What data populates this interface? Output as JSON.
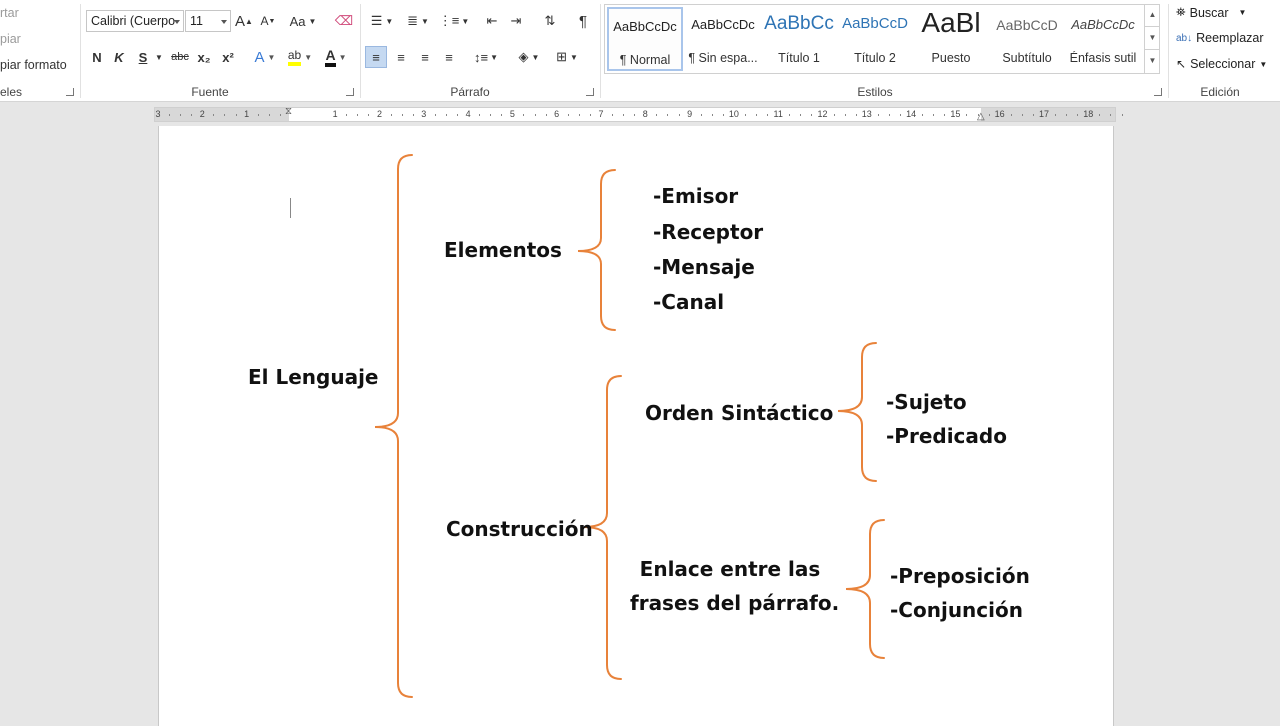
{
  "clipboard": {
    "cut_label": "rtar",
    "copy_label": "piar",
    "format_painter_label": "piar formato",
    "group_label": "eles"
  },
  "font": {
    "family_value": "Calibri (Cuerpo",
    "size_value": "11",
    "group_label": "Fuente",
    "bold": "N",
    "italic": "K",
    "underline": "S",
    "strikethrough": "abc",
    "subscript": "x₂",
    "superscript": "x²",
    "grow": "A",
    "shrink": "A",
    "change_case": "Aa"
  },
  "paragraph": {
    "group_label": "Párrafo"
  },
  "styles": {
    "group_label": "Estilos",
    "items": [
      {
        "sample": "AaBbCcDc",
        "name": "¶ Normal",
        "selected": true
      },
      {
        "sample": "AaBbCcDc",
        "name": "¶ Sin espa..."
      },
      {
        "sample": "AaBbCc",
        "name": "Título 1"
      },
      {
        "sample": "AaBbCcD",
        "name": "Título 2"
      },
      {
        "sample": "AaBl",
        "name": "Puesto"
      },
      {
        "sample": "AaBbCcD",
        "name": "Subtítulo"
      },
      {
        "sample": "AaBbCcDc",
        "name": "Énfasis sutil"
      }
    ]
  },
  "editing": {
    "group_label": "Edición",
    "find_label": "Buscar",
    "replace_label": "Reemplazar",
    "select_label": "Seleccionar"
  },
  "ruler": {
    "numbers": [
      "3",
      "2",
      "1",
      "1",
      "2",
      "3",
      "4",
      "5",
      "6",
      "7",
      "8",
      "9",
      "10",
      "11",
      "12",
      "13",
      "14",
      "15",
      "16",
      "17",
      "18"
    ]
  },
  "concept_map": {
    "root": "El Lenguaje",
    "elementos": {
      "title": "Elementos",
      "items": [
        "-Emisor",
        "-Receptor",
        "-Mensaje",
        "-Canal"
      ]
    },
    "construccion": {
      "title": "Construcción",
      "orden": {
        "title": "Orden Sintáctico",
        "items": [
          "-Sujeto",
          "-Predicado"
        ]
      },
      "enlace": {
        "title_line1": "Enlace entre las",
        "title_line2": "frases del párrafo.",
        "items": [
          "-Preposición",
          "-Conjunción"
        ]
      }
    }
  },
  "colors": {
    "brace": "#e8823a",
    "active_button": "#c5d9f1",
    "style_link_blue": "#2e74b5"
  }
}
